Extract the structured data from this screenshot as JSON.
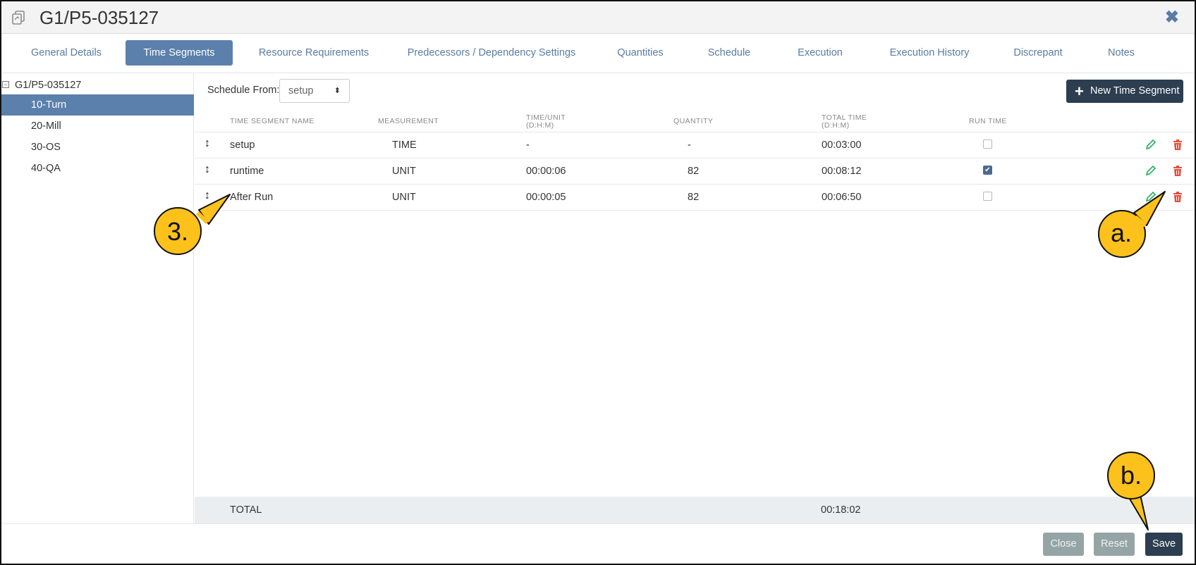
{
  "window": {
    "title": "G1/P5-035127",
    "close_symbol": "✖"
  },
  "tabs": [
    {
      "label": "General Details",
      "active": false
    },
    {
      "label": "Time Segments",
      "active": true
    },
    {
      "label": "Resource Requirements",
      "active": false
    },
    {
      "label": "Predecessors / Dependency Settings",
      "active": false
    },
    {
      "label": "Quantities",
      "active": false
    },
    {
      "label": "Schedule",
      "active": false
    },
    {
      "label": "Execution",
      "active": false
    },
    {
      "label": "Execution History",
      "active": false
    },
    {
      "label": "Discrepant",
      "active": false
    },
    {
      "label": "Notes",
      "active": false
    }
  ],
  "tree": {
    "root": "G1/P5-035127",
    "items": [
      {
        "label": "10-Turn",
        "active": true
      },
      {
        "label": "20-Mill",
        "active": false
      },
      {
        "label": "30-OS",
        "active": false
      },
      {
        "label": "40-QA",
        "active": false
      }
    ]
  },
  "toolbar": {
    "schedule_from_label": "Schedule From:",
    "schedule_from_value": "setup",
    "new_segment_label": "New Time Segment"
  },
  "table": {
    "headers": {
      "name": "TIME SEGMENT NAME",
      "measurement": "MEASUREMENT",
      "time_unit_1": "TIME/UNIT",
      "time_unit_2": "(D:H:M)",
      "quantity": "QUANTITY",
      "total_time_1": "TOTAL TIME",
      "total_time_2": "(D:H:M)",
      "run_time": "RUN TIME"
    },
    "rows": [
      {
        "name": "setup",
        "measurement": "TIME",
        "time_unit": "-",
        "quantity": "-",
        "total_time": "00:03:00",
        "run_time": false
      },
      {
        "name": "runtime",
        "measurement": "UNIT",
        "time_unit": "00:00:06",
        "quantity": "82",
        "total_time": "00:08:12",
        "run_time": true
      },
      {
        "name": "After Run",
        "measurement": "UNIT",
        "time_unit": "00:00:05",
        "quantity": "82",
        "total_time": "00:06:50",
        "run_time": false
      }
    ],
    "total_label": "TOTAL",
    "total_value": "00:18:02"
  },
  "footer": {
    "close_label": "Close",
    "reset_label": "Reset",
    "save_label": "Save"
  },
  "callouts": {
    "three": "3.",
    "a": "a.",
    "b": "b."
  },
  "colors": {
    "accent": "#5b80ab",
    "dark_button": "#2c3e50",
    "edit_green": "#27ae60",
    "delete_red": "#e74c3c",
    "callout_fill": "#fcc21b"
  }
}
